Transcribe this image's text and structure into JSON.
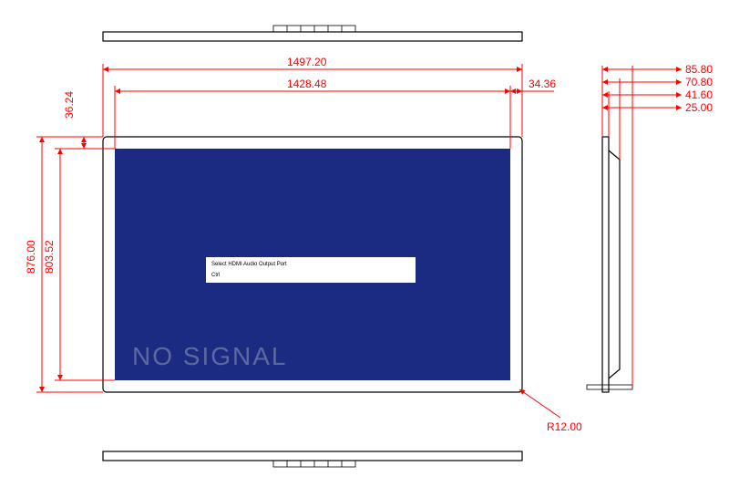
{
  "type": "engineering-drawing",
  "subject": "display-monitor",
  "dimensions_mm": {
    "overall_width": 1497.2,
    "active_width": 1428.48,
    "side_bezel": 34.36,
    "top_bezel": 36.24,
    "overall_height": 876.0,
    "active_height": 803.52,
    "corner_radius": 12.0,
    "depth_a": 85.8,
    "depth_b": 70.8,
    "depth_c": 41.6,
    "depth_d": 25.0
  },
  "labels": {
    "overall_width": "1497.20",
    "active_width": "1428.48",
    "side_bezel": "34.36",
    "top_bezel": "36.24",
    "overall_height": "876.00",
    "active_height": "803.52",
    "corner_radius": "R12.00",
    "depth_a": "85.80",
    "depth_b": "70.80",
    "depth_c": "41.60",
    "depth_d": "25.00",
    "no_signal": "NO SIGNAL",
    "popup_line1": "Select HDMI Audio Output Port",
    "popup_line2": "Ctrl"
  }
}
